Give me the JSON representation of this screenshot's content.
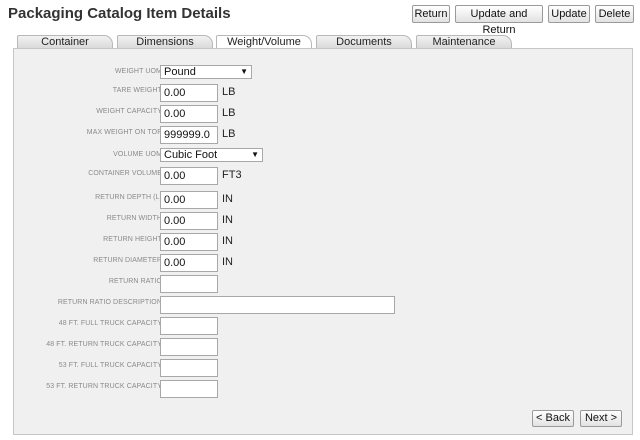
{
  "page_title": "Packaging Catalog Item Details",
  "toolbar": {
    "return_label": "Return",
    "update_and_return_label": "Update and Return",
    "update_label": "Update",
    "delete_label": "Delete"
  },
  "tabs": [
    {
      "label": "Container"
    },
    {
      "label": "Dimensions"
    },
    {
      "label": "Weight/Volume",
      "active": true
    },
    {
      "label": "Documents"
    },
    {
      "label": "Maintenance"
    }
  ],
  "form": {
    "weight_uom": {
      "label": "WEIGHT UOM",
      "value": "Pound"
    },
    "tare_weight": {
      "label": "TARE WEIGHT",
      "value": "0.00",
      "unit": "LB"
    },
    "weight_capacity": {
      "label": "WEIGHT CAPACITY",
      "value": "0.00",
      "unit": "LB"
    },
    "max_weight_on_top": {
      "label": "MAX WEIGHT ON TOP",
      "value": "999999.0",
      "unit": "LB"
    },
    "volume_uom": {
      "label": "VOLUME UOM",
      "value": "Cubic Foot"
    },
    "container_volume": {
      "label": "CONTAINER VOLUME",
      "value": "0.00",
      "unit": "FT3"
    },
    "return_depth": {
      "label": "RETURN DEPTH (L)",
      "value": "0.00",
      "unit": "IN"
    },
    "return_width": {
      "label": "RETURN WIDTH",
      "value": "0.00",
      "unit": "IN"
    },
    "return_height": {
      "label": "RETURN HEIGHT",
      "value": "0.00",
      "unit": "IN"
    },
    "return_diameter": {
      "label": "RETURN DIAMETER",
      "value": "0.00",
      "unit": "IN"
    },
    "return_ratio": {
      "label": "RETURN RATIO",
      "value": ""
    },
    "return_ratio_description": {
      "label": "RETURN RATIO DESCRIPTION",
      "value": ""
    },
    "full_truck_48": {
      "label": "48 FT. FULL TRUCK CAPACITY",
      "value": ""
    },
    "return_truck_48": {
      "label": "48 FT. RETURN TRUCK CAPACITY",
      "value": ""
    },
    "full_truck_53": {
      "label": "53 FT. FULL TRUCK CAPACITY",
      "value": ""
    },
    "return_truck_53": {
      "label": "53 FT. RETURN TRUCK CAPACITY",
      "value": ""
    }
  },
  "nav": {
    "back_label": "< Back",
    "next_label": "Next >"
  },
  "icons": {
    "dropdown": "chevron-down-icon"
  },
  "colors": {
    "panel_bg": "#f0f0f0",
    "label_text": "#8a8a8a",
    "border": "#c6c6c6"
  }
}
